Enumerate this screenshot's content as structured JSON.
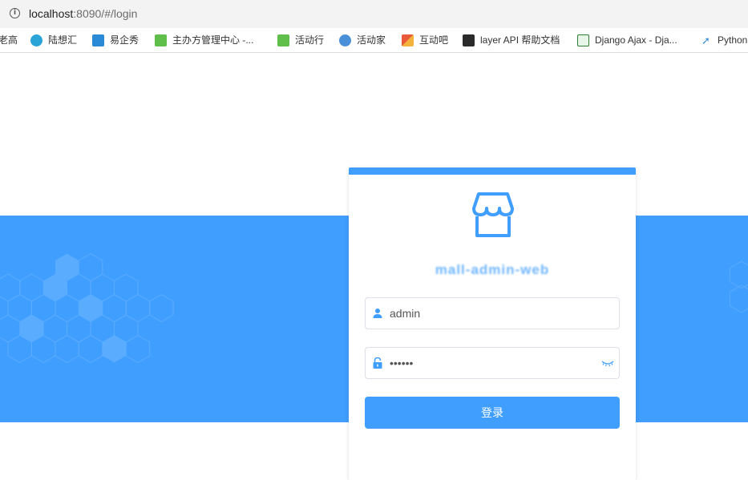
{
  "browser": {
    "url_host": "localhost",
    "url_rest": ":8090/#/login"
  },
  "bookmarks": [
    {
      "label": "老高",
      "color": "#ffffff"
    },
    {
      "label": "陆想汇",
      "color": "#2aa3d6"
    },
    {
      "label": "易企秀",
      "color": "#2a8ad6"
    },
    {
      "label": "主办方管理中心 -...",
      "color": "#5fbf4a"
    },
    {
      "label": "活动行",
      "color": "#5fbf4a"
    },
    {
      "label": "活动家",
      "color": "#4a90d9"
    },
    {
      "label": "互动吧",
      "color": "#e85a3a"
    },
    {
      "label": "layer API 帮助文档",
      "color": "#2b2b2b"
    },
    {
      "label": "Django Ajax - Dja...",
      "color": "#2e7d32"
    },
    {
      "label": "Python",
      "color": "#3a8fd6"
    }
  ],
  "login": {
    "title": "mall-admin-web",
    "username_value": "admin",
    "password_value": "••••••",
    "submit_label": "登录"
  },
  "colors": {
    "primary": "#409eff",
    "band": "#409eff",
    "hexagon": "#5aacff"
  },
  "icons": {
    "logo": "store-icon",
    "username": "user-icon",
    "password": "lock-icon",
    "toggle": "eye-closed-icon",
    "address": "info-icon"
  }
}
